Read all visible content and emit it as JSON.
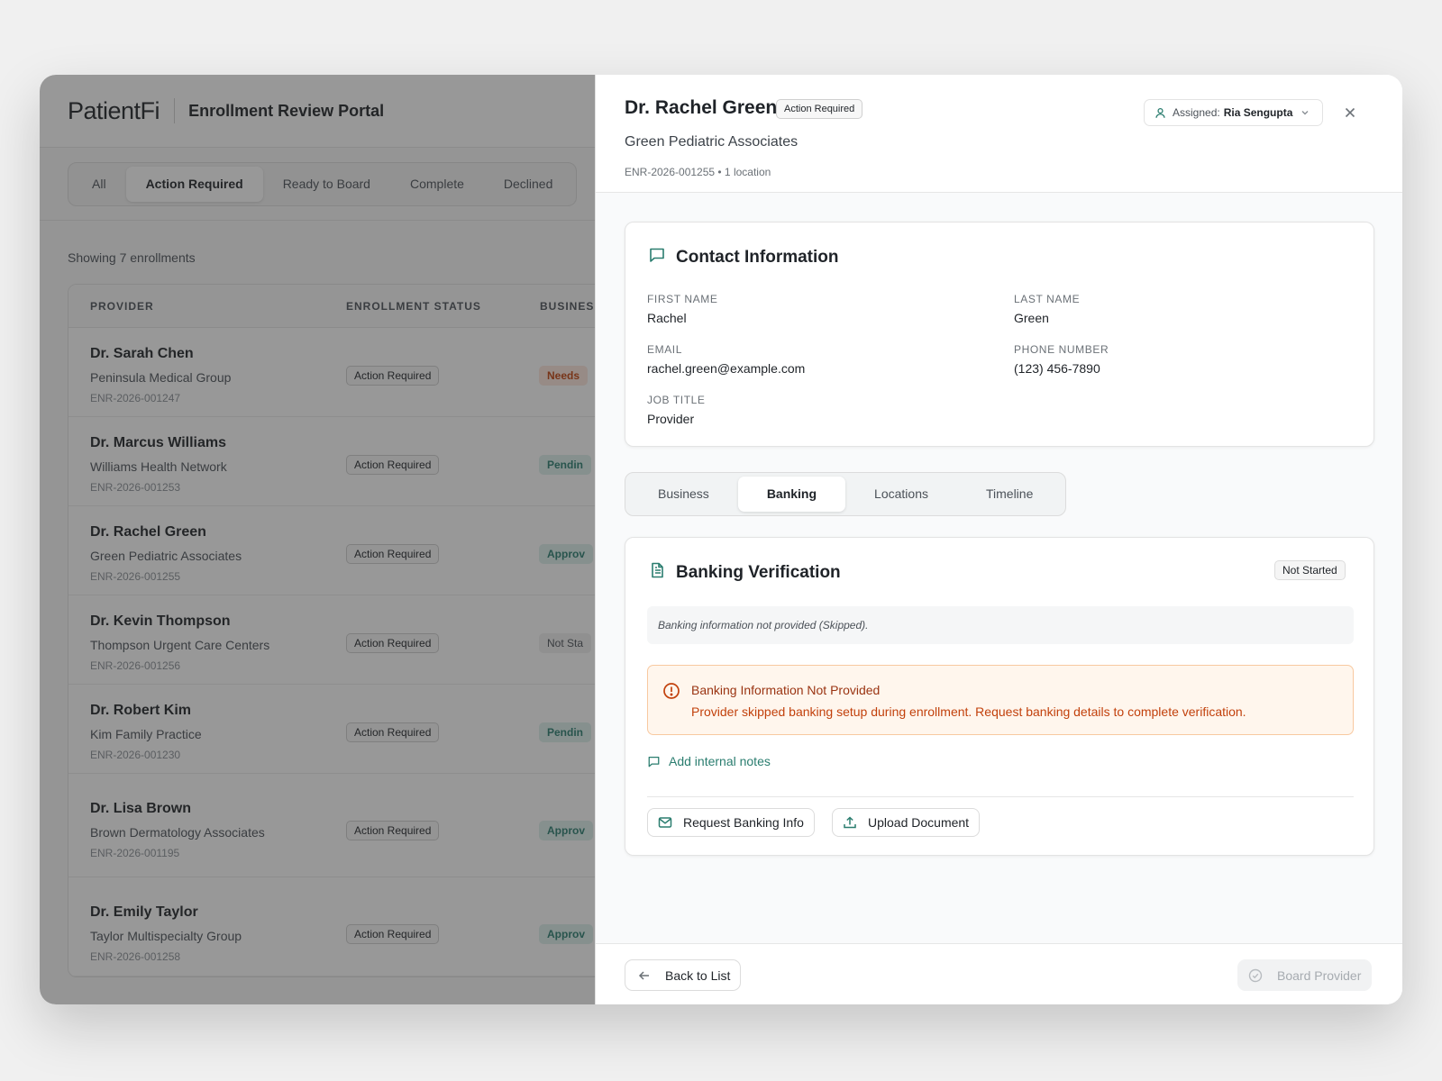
{
  "app": {
    "logo": "PatientFi",
    "title": "Enrollment Review Portal"
  },
  "filters": [
    "All",
    "Action Required",
    "Ready to Board",
    "Complete",
    "Declined"
  ],
  "active_filter": "Action Required",
  "list": {
    "showing": "Showing 7 enrollments",
    "columns": [
      "PROVIDER",
      "ENROLLMENT STATUS",
      "BUSINES"
    ],
    "rows": [
      {
        "name": "Dr. Sarah Chen",
        "org": "Peninsula Medical Group",
        "enr": "ENR-2026-001247",
        "status": "Action Required",
        "business": "Needs",
        "business_tone": "red"
      },
      {
        "name": "Dr. Marcus Williams",
        "org": "Williams Health Network",
        "enr": "ENR-2026-001253",
        "status": "Action Required",
        "business": "Pendin",
        "business_tone": "teal"
      },
      {
        "name": "Dr. Rachel Green",
        "org": "Green Pediatric Associates",
        "enr": "ENR-2026-001255",
        "status": "Action Required",
        "business": "Approv",
        "business_tone": "teal"
      },
      {
        "name": "Dr. Kevin Thompson",
        "org": "Thompson Urgent Care Centers",
        "enr": "ENR-2026-001256",
        "status": "Action Required",
        "business": "Not Sta",
        "business_tone": "gray"
      },
      {
        "name": "Dr. Robert Kim",
        "org": "Kim Family Practice",
        "enr": "ENR-2026-001230",
        "status": "Action Required",
        "business": "Pendin",
        "business_tone": "teal"
      },
      {
        "name": "Dr. Lisa Brown",
        "org": "Brown Dermatology Associates",
        "enr": "ENR-2026-001195",
        "status": "Action Required",
        "business": "Approv",
        "business_tone": "teal"
      },
      {
        "name": "Dr. Emily Taylor",
        "org": "Taylor Multispecialty Group",
        "enr": "ENR-2026-001258",
        "status": "Action Required",
        "business": "Approv",
        "business_tone": "teal"
      }
    ]
  },
  "drawer": {
    "name": "Dr. Rachel Green",
    "status": "Action Required",
    "org": "Green Pediatric Associates",
    "meta": "ENR-2026-001255 • 1 location",
    "assigned_label": "Assigned:",
    "assigned_name": "Ria Sengupta",
    "contact": {
      "title": "Contact Information",
      "first_name_label": "FIRST NAME",
      "first_name": "Rachel",
      "last_name_label": "LAST NAME",
      "last_name": "Green",
      "email_label": "EMAIL",
      "email": "rachel.green@example.com",
      "phone_label": "PHONE NUMBER",
      "phone": "(123) 456-7890",
      "job_label": "JOB TITLE",
      "job": "Provider"
    },
    "tabs": [
      "Business",
      "Banking",
      "Locations",
      "Timeline"
    ],
    "active_tab": "Banking",
    "banking": {
      "title": "Banking Verification",
      "status": "Not Started",
      "note": "Banking information not provided (Skipped).",
      "alert_title": "Banking Information Not Provided",
      "alert_body": "Provider skipped banking setup during enrollment. Request banking details to complete verification.",
      "add_notes": "Add internal notes",
      "request_btn": "Request Banking Info",
      "upload_btn": "Upload Document"
    },
    "footer": {
      "back": "Back to List",
      "board": "Board Provider"
    }
  },
  "colors": {
    "accent": "#2a7d6f",
    "alert_bg": "#fff6ed",
    "alert_text": "#c2410c"
  }
}
